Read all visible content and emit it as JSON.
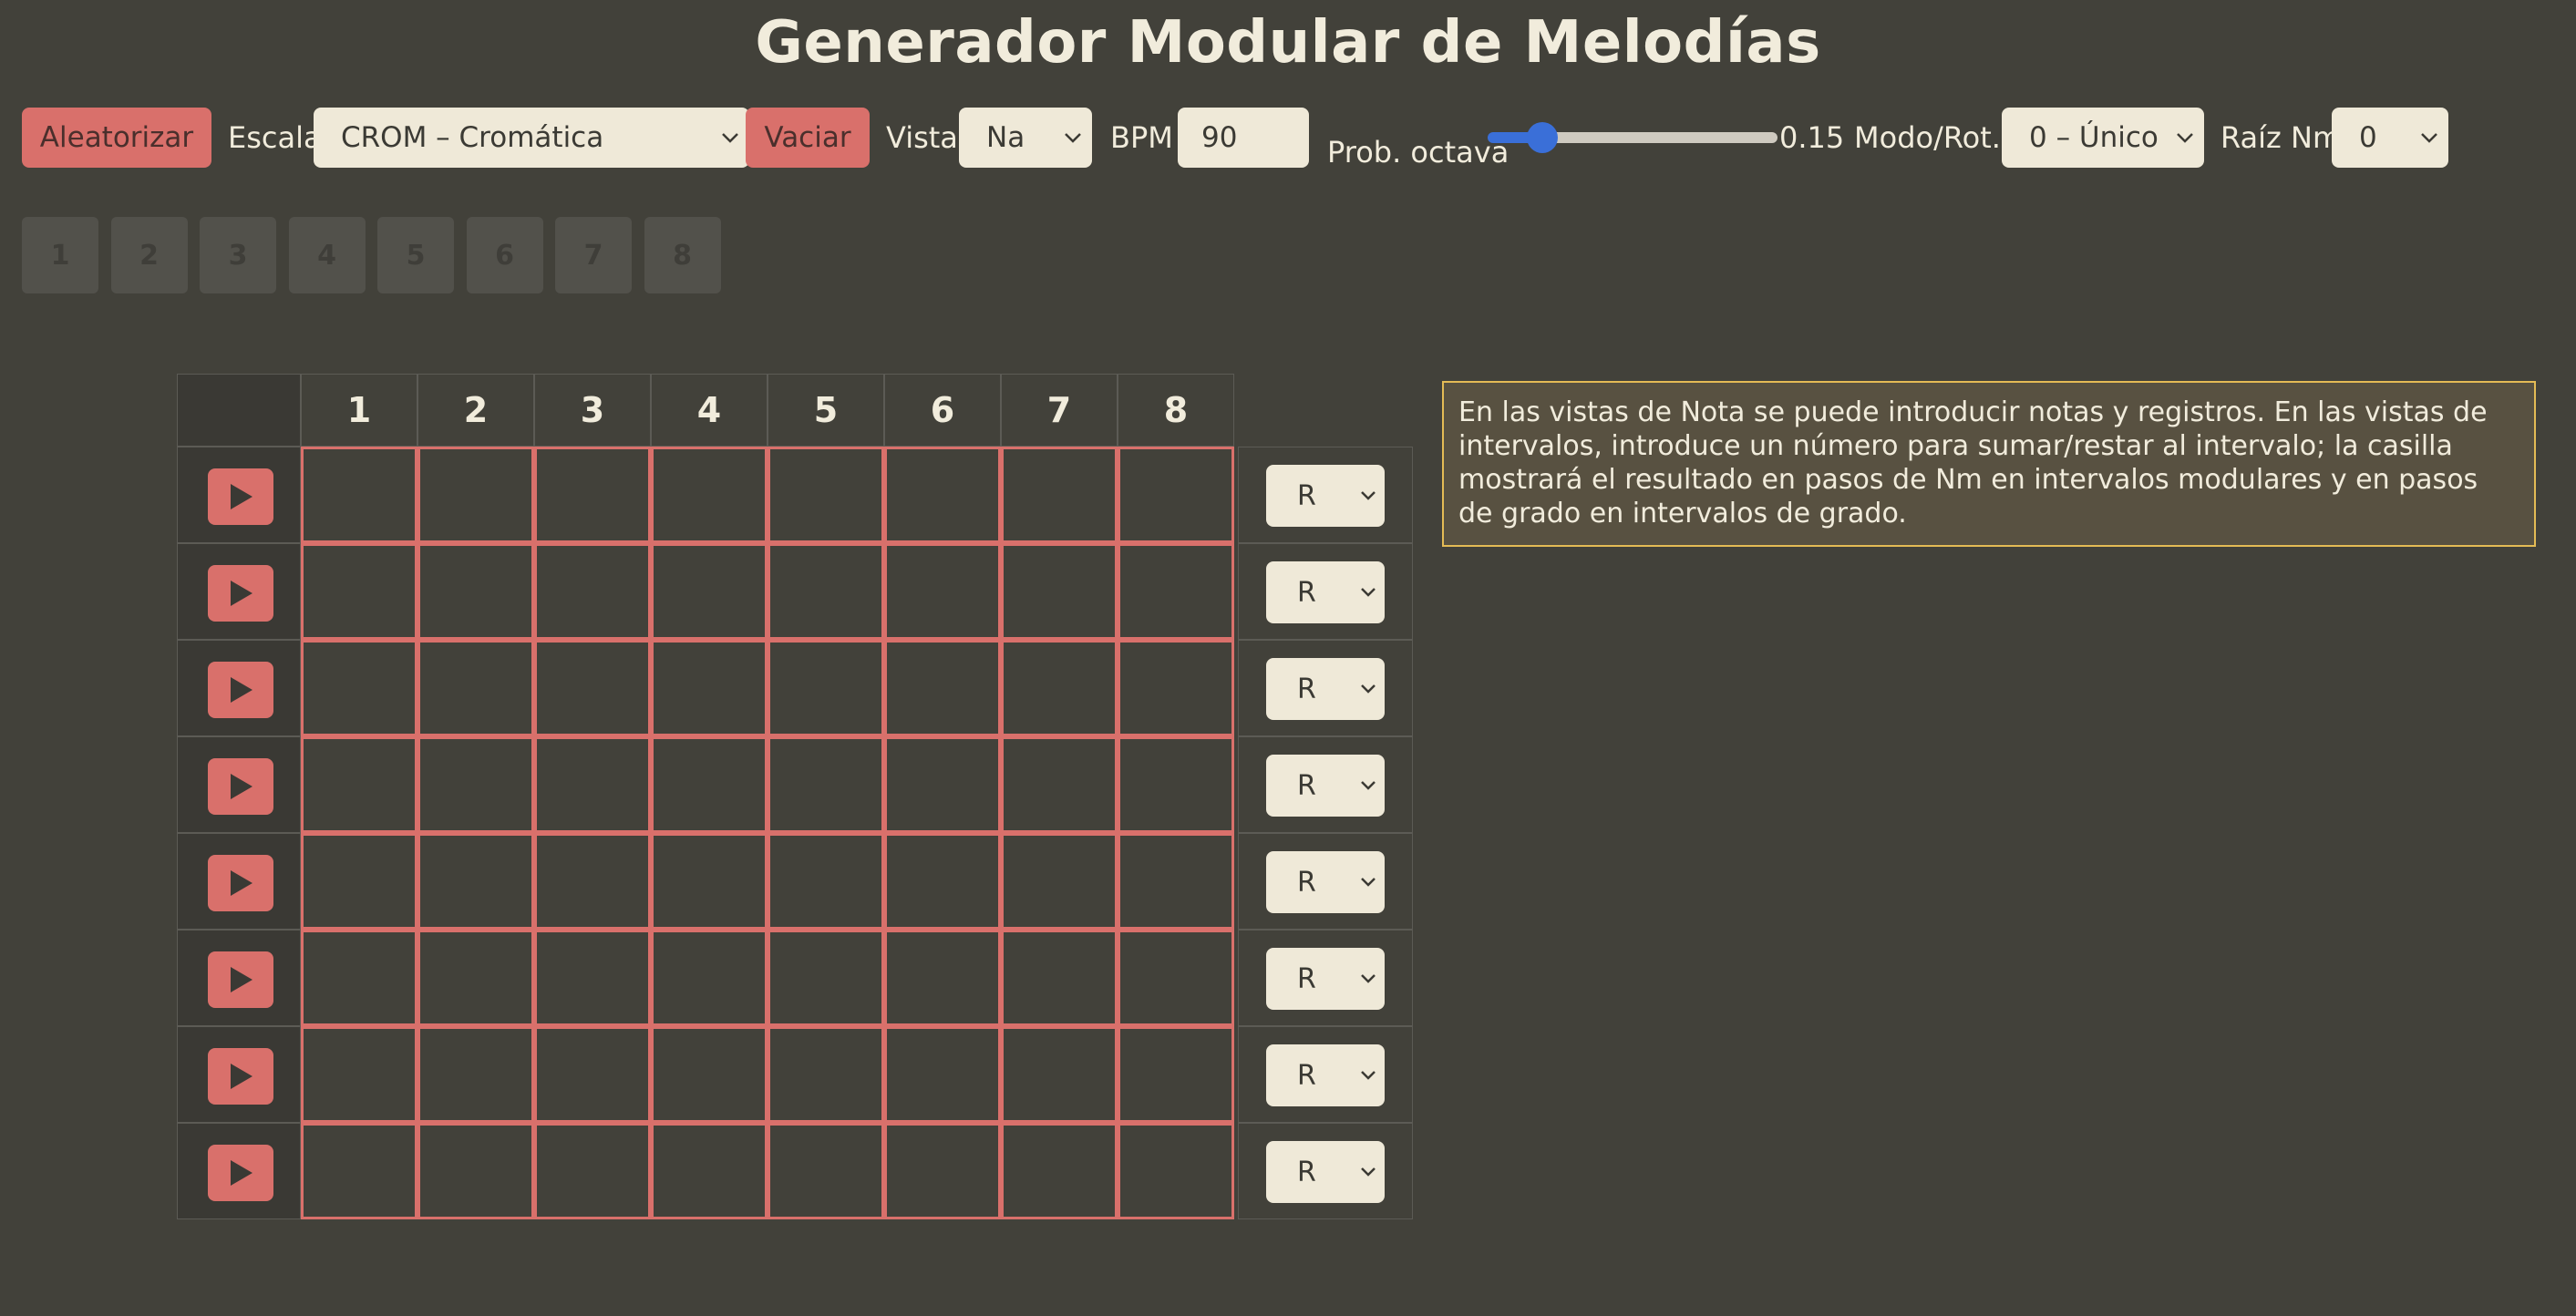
{
  "title": "Generador Modular de Melodías",
  "toolbar": {
    "randomize_label": "Aleatorizar",
    "scale_label": "Escala",
    "scale_value": "CROM – Cromática",
    "clear_label": "Vaciar",
    "view_label": "Vista",
    "view_value": "Na",
    "bpm_label": "BPM",
    "bpm_value": "90",
    "octave_prob_label": "Prob. octava",
    "octave_prob_value": "0.15",
    "octave_prob_fraction": 0.15,
    "mode_label": "Modo/Rot.",
    "mode_value": "0 – Único",
    "root_label": "Raíz Nm",
    "root_value": "0"
  },
  "sequence_buttons": [
    "1",
    "2",
    "3",
    "4",
    "5",
    "6",
    "7",
    "8"
  ],
  "grid": {
    "columns": [
      "1",
      "2",
      "3",
      "4",
      "5",
      "6",
      "7",
      "8"
    ],
    "row_count": 8,
    "row_select_values": [
      "R",
      "R",
      "R",
      "R",
      "R",
      "R",
      "R",
      "R"
    ]
  },
  "info_text": "En las vistas de Nota se puede introducir notas y registros. En las vistas de intervalos, introduce un número para sumar/restar al intervalo; la casilla mostrará el resultado en pasos de Nm en intervalos modulares y en pasos de grado en intervalos de grado.",
  "colors": {
    "background": "#42413a",
    "accent_red": "#d9706b",
    "slider_blue": "#3a6fd8",
    "info_border": "#e4bb55"
  },
  "icons": {
    "play": "play-icon",
    "chevron": "chevron-down-icon"
  }
}
